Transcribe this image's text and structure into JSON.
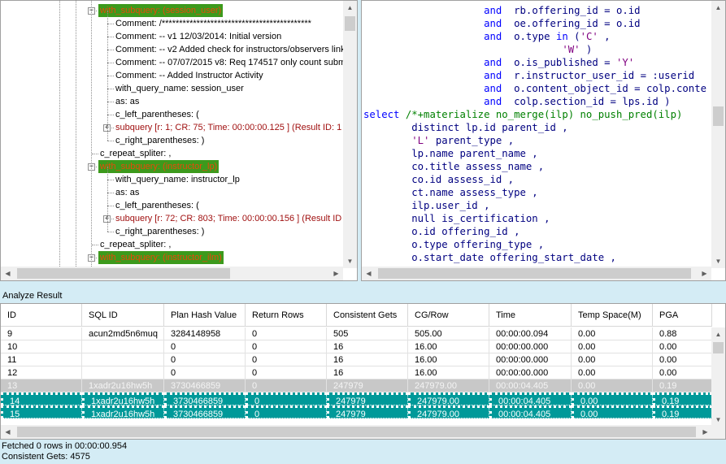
{
  "tree": {
    "nodes": [
      {
        "text": "with_subquery: (session_user)",
        "style": "hl"
      },
      {
        "text": "Comment: /*******************************************",
        "style": "plain"
      },
      {
        "text": "Comment: -- v1 12/03/2014: Initial version",
        "style": "plain"
      },
      {
        "text": "Comment: -- v2 Added check for instructors/observers link",
        "style": "plain"
      },
      {
        "text": "Comment: -- 07/07/2015 v8: Req 174517 only count subm",
        "style": "plain"
      },
      {
        "text": "Comment: -- Added Instructor Activity",
        "style": "plain"
      },
      {
        "text": "with_query_name: session_user",
        "style": "plain"
      },
      {
        "text": "as: as",
        "style": "plain"
      },
      {
        "text": "c_left_parentheses: (",
        "style": "plain"
      },
      {
        "text": "subquery [r: 1; CR: 75; Time: 00:00:00.125 ] (Result ID: 1",
        "style": "red"
      },
      {
        "text": "c_right_parentheses: )",
        "style": "plain"
      },
      {
        "text": "c_repeat_spliter: ,",
        "style": "plain"
      },
      {
        "text": "with_subquery: (instructor_lp)",
        "style": "hl"
      },
      {
        "text": "with_query_name: instructor_lp",
        "style": "plain"
      },
      {
        "text": "as: as",
        "style": "plain"
      },
      {
        "text": "c_left_parentheses: (",
        "style": "plain"
      },
      {
        "text": "subquery [r: 72; CR: 803; Time: 00:00:00.156 ] (Result ID",
        "style": "red"
      },
      {
        "text": "c_right_parentheses: )",
        "style": "plain"
      },
      {
        "text": "c_repeat_spliter: ,",
        "style": "plain"
      },
      {
        "text": "with_subquery: (instructor_ilm)",
        "style": "hl"
      }
    ]
  },
  "sql": {
    "lines": [
      [
        [
          "",
          "                    "
        ],
        [
          "kw",
          "and"
        ],
        [
          "",
          "  rb.offering_id = o.id"
        ]
      ],
      [
        [
          "",
          "                    "
        ],
        [
          "kw",
          "and"
        ],
        [
          "",
          "  oe.offering_id = o.id"
        ]
      ],
      [
        [
          "",
          "                    "
        ],
        [
          "kw",
          "and"
        ],
        [
          "",
          "  o.type "
        ],
        [
          "kw",
          "in"
        ],
        [
          "",
          " ("
        ],
        [
          "str",
          "'C'"
        ],
        [
          "",
          " ,"
        ]
      ],
      [
        [
          "",
          "                                 "
        ],
        [
          "str",
          "'W'"
        ],
        [
          "",
          " )"
        ]
      ],
      [
        [
          "",
          "                    "
        ],
        [
          "kw",
          "and"
        ],
        [
          "",
          "  o.is_published = "
        ],
        [
          "str",
          "'Y'"
        ]
      ],
      [
        [
          "",
          "                    "
        ],
        [
          "kw",
          "and"
        ],
        [
          "",
          "  r.instructor_user_id = :userid"
        ]
      ],
      [
        [
          "",
          "                    "
        ],
        [
          "kw",
          "and"
        ],
        [
          "",
          "  o.content_object_id = colp.conte"
        ]
      ],
      [
        [
          "",
          "                    "
        ],
        [
          "kw",
          "and"
        ],
        [
          "",
          "  colp.section_id = lps.id )"
        ]
      ],
      [
        [
          "kw",
          "select"
        ],
        [
          "",
          " "
        ],
        [
          "cmt",
          "/*+materialize no_merge(ilp) no_push_pred(ilp)"
        ]
      ],
      [
        [
          "",
          "        distinct lp.id parent_id ,"
        ]
      ],
      [
        [
          "",
          "        "
        ],
        [
          "str",
          "'L'"
        ],
        [
          "",
          " parent_type ,"
        ]
      ],
      [
        [
          "",
          "        lp.name parent_name ,"
        ]
      ],
      [
        [
          "",
          "        co.title assess_name ,"
        ]
      ],
      [
        [
          "",
          "        co.id assess_id ,"
        ]
      ],
      [
        [
          "",
          "        ct.name assess_type ,"
        ]
      ],
      [
        [
          "",
          "        ilp.user_id ,"
        ]
      ],
      [
        [
          "",
          "        null is_certification ,"
        ]
      ],
      [
        [
          "",
          "        o.id offering_id ,"
        ]
      ],
      [
        [
          "",
          "        o.type offering_type ,"
        ]
      ],
      [
        [
          "",
          "        o.start_date offering_start_date ,"
        ]
      ]
    ]
  },
  "result": {
    "title": "Analyze Result",
    "columns": [
      "ID",
      "SQL ID",
      "Plan Hash Value",
      "Return Rows",
      "Consistent Gets",
      "CG/Row",
      "Time",
      "Temp Space(M)",
      "PGA"
    ],
    "rows": [
      {
        "state": "normal",
        "cells": [
          "9",
          "acun2md5n6muq",
          "3284148958",
          "0",
          "505",
          "505.00",
          "00:00:00.094",
          "0.00",
          "0.88"
        ]
      },
      {
        "state": "normal",
        "cells": [
          "10",
          "",
          "0",
          "0",
          "16",
          "16.00",
          "00:00:00.000",
          "0.00",
          "0.00"
        ]
      },
      {
        "state": "normal",
        "cells": [
          "11",
          "",
          "0",
          "0",
          "16",
          "16.00",
          "00:00:00.000",
          "0.00",
          "0.00"
        ]
      },
      {
        "state": "normal",
        "cells": [
          "12",
          "",
          "0",
          "0",
          "16",
          "16.00",
          "00:00:00.000",
          "0.00",
          "0.00"
        ]
      },
      {
        "state": "gray",
        "cells": [
          "13",
          "1xadr2u16hw5h",
          "3730466859",
          "0",
          "247979",
          "247979.00",
          "00:00:04.405",
          "0.00",
          "0.19"
        ]
      },
      {
        "state": "sel",
        "cells": [
          "14",
          "1xadr2u16hw5h",
          "3730466859",
          "0",
          "247979",
          "247979.00",
          "00:00:04.405",
          "0.00",
          "0.19"
        ]
      },
      {
        "state": "sel",
        "cells": [
          "15",
          "1xadr2u16hw5h",
          "3730466859",
          "0",
          "247979",
          "247979.00",
          "00:00:04.405",
          "0.00",
          "0.19"
        ]
      }
    ]
  },
  "status": {
    "fetched": "Fetched 0 rows in 00:00:00.954",
    "consistent_gets": "Consistent Gets: 4575"
  },
  "colors": {
    "highlight_bg": "#3c9a1c",
    "highlight_fg": "#e84a0a",
    "selected_row": "#009999"
  }
}
